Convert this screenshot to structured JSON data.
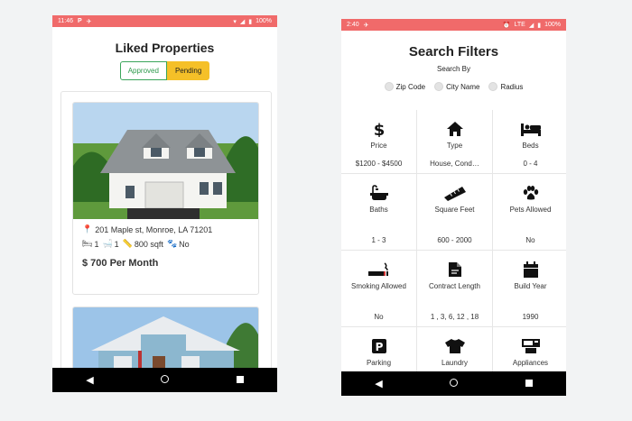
{
  "left": {
    "status": {
      "time": "11:46",
      "battery": "100%"
    },
    "title": "Liked Properties",
    "tabs": {
      "approved": "Approved",
      "pending": "Pending"
    },
    "listings": [
      {
        "address": "201 Maple st, Monroe, LA 71201",
        "beds": "1",
        "baths": "1",
        "sqft": "800 sqft",
        "pets": "No",
        "price": "$ 700 Per Month"
      }
    ]
  },
  "right": {
    "status": {
      "time": "2:40",
      "network": "LTE",
      "battery": "100%"
    },
    "title": "Search Filters",
    "search_by": "Search By",
    "options": [
      "Zip Code",
      "City Name",
      "Radius"
    ],
    "filters": [
      {
        "icon": "dollar-icon",
        "label": "Price",
        "value": "$1200 - $4500"
      },
      {
        "icon": "home-icon",
        "label": "Type",
        "value": "House, Cond…"
      },
      {
        "icon": "bed-icon",
        "label": "Beds",
        "value": "0 - 4"
      },
      {
        "icon": "bath-icon",
        "label": "Baths",
        "value": "1 - 3"
      },
      {
        "icon": "ruler-icon",
        "label": "Square Feet",
        "value": "600 - 2000"
      },
      {
        "icon": "paw-icon",
        "label": "Pets Allowed",
        "value": "No"
      },
      {
        "icon": "smoking-icon",
        "label": "Smoking Allowed",
        "value": "No"
      },
      {
        "icon": "contract-icon",
        "label": "Contract Length",
        "value": "1 , 3, 6, 12 , 18"
      },
      {
        "icon": "calendar-icon",
        "label": "Build Year",
        "value": "1990"
      },
      {
        "icon": "parking-icon",
        "label": "Parking",
        "value": ""
      },
      {
        "icon": "shirt-icon",
        "label": "Laundry",
        "value": ""
      },
      {
        "icon": "appliances-icon",
        "label": "Appliances",
        "value": ""
      }
    ]
  }
}
